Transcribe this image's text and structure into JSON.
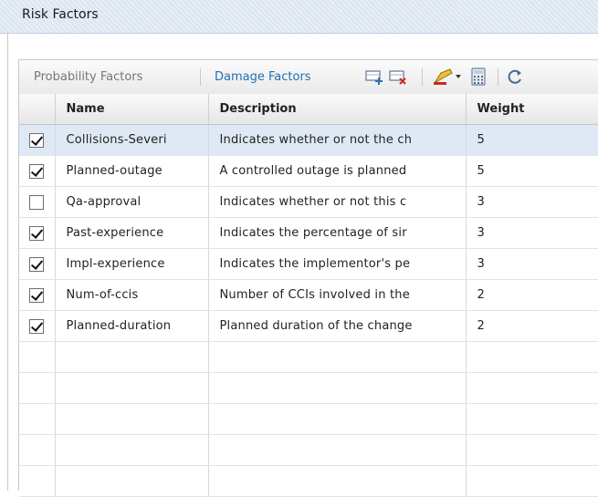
{
  "window": {
    "title": "Risk Factors"
  },
  "toolbar": {
    "tab_probability": "Probability Factors",
    "tab_damage": "Damage Factors",
    "icons": [
      "add-row-icon",
      "delete-row-icon",
      "highlight-dropdown-icon",
      "calculator-icon",
      "refresh-icon"
    ]
  },
  "grid": {
    "columns": {
      "name": "Name",
      "description": "Description",
      "weight": "Weight"
    },
    "rows": [
      {
        "checked": true,
        "name": "Collisions-Severi",
        "description": "Indicates whether or not the ch",
        "weight": "5",
        "selected": true
      },
      {
        "checked": true,
        "name": "Planned-outage",
        "description": "A controlled outage is planned",
        "weight": "5"
      },
      {
        "checked": false,
        "name": "Qa-approval",
        "description": "Indicates whether or not this c",
        "weight": "3"
      },
      {
        "checked": true,
        "name": "Past-experience",
        "description": "Indicates the percentage of sir",
        "weight": "3"
      },
      {
        "checked": true,
        "name": "Impl-experience",
        "description": "Indicates the implementor's pe",
        "weight": "3"
      },
      {
        "checked": true,
        "name": "Num-of-ccis",
        "description": "Number of CCIs involved in the",
        "weight": "2"
      },
      {
        "checked": true,
        "name": "Planned-duration",
        "description": "Planned duration of the change",
        "weight": "2"
      }
    ],
    "empty_rows": 5
  },
  "colors": {
    "link": "#1f6fb5",
    "selected_row": "#dfe9f5",
    "header_band": "#e2eaf4"
  }
}
